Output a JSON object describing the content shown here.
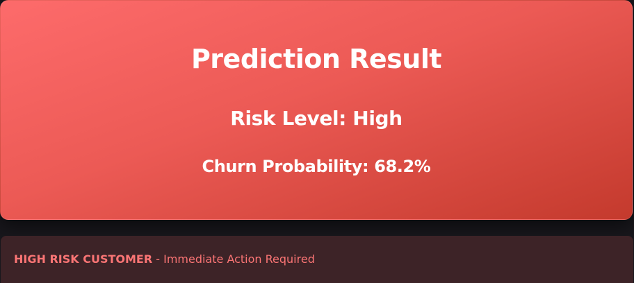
{
  "result_card": {
    "title": "Prediction Result",
    "risk_level_text": "Risk Level: High",
    "churn_probability_text": "Churn Probability: 68.2%"
  },
  "alert": {
    "strong_label": "HIGH RISK CUSTOMER",
    "message": " - Immediate Action Required"
  },
  "colors": {
    "card_gradient_start": "#fd6b6b",
    "card_gradient_end": "#c43a2d",
    "alert_background": "#3d2327",
    "alert_text": "#fb7575"
  }
}
